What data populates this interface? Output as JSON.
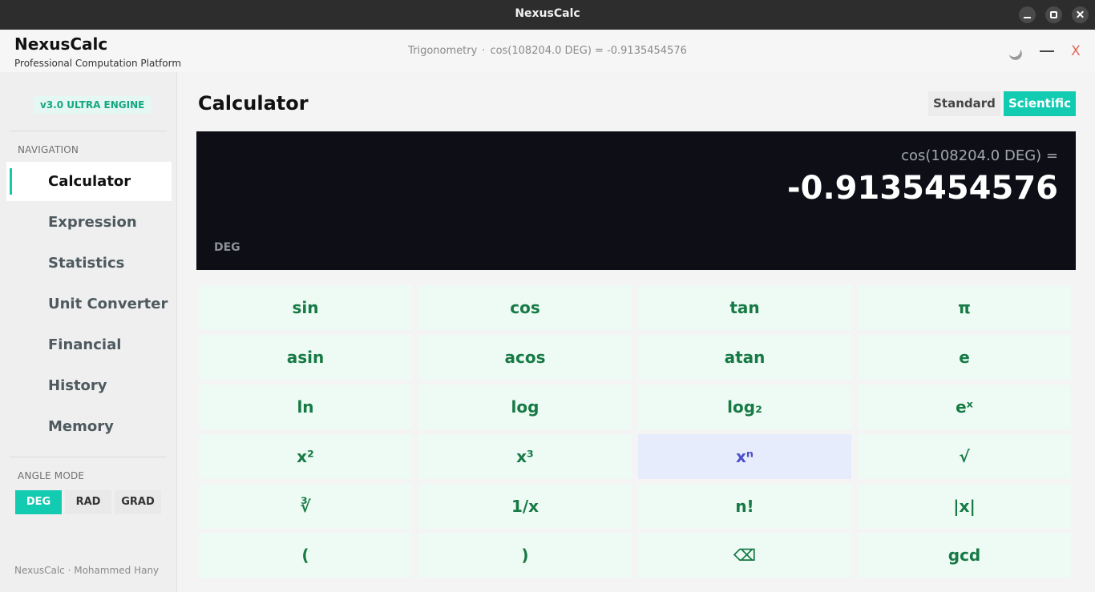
{
  "window": {
    "title": "NexusCalc"
  },
  "header": {
    "app_name": "NexusCalc",
    "tagline": "Professional Computation Platform",
    "status_category": "Trigonometry",
    "status_separator": "·",
    "status_text": "cos(108204.0 DEG) = -0.9135454576",
    "close_label": "X"
  },
  "sidebar": {
    "version_badge": "v3.0  ULTRA ENGINE",
    "nav_heading": "NAVIGATION",
    "nav_items": [
      {
        "label": "Calculator",
        "active": true
      },
      {
        "label": "Expression"
      },
      {
        "label": "Statistics"
      },
      {
        "label": "Unit Converter"
      },
      {
        "label": "Financial"
      },
      {
        "label": "History"
      },
      {
        "label": "Memory"
      }
    ],
    "angle_heading": "ANGLE MODE",
    "angle_modes": [
      {
        "label": "DEG",
        "active": true
      },
      {
        "label": "RAD"
      },
      {
        "label": "GRAD"
      }
    ],
    "footer": "NexusCalc · Mohammed Hany"
  },
  "main": {
    "title": "Calculator",
    "modes": [
      {
        "label": "Standard"
      },
      {
        "label": "Scientific",
        "active": true
      }
    ],
    "display": {
      "expression": "cos(108204.0 DEG) =",
      "result": "-0.9135454576",
      "angle_mode": "DEG"
    },
    "keys": [
      [
        "sin",
        "cos",
        "tan",
        "π"
      ],
      [
        "asin",
        "acos",
        "atan",
        "e"
      ],
      [
        "ln",
        "log",
        "log₂",
        "eˣ"
      ],
      [
        "x²",
        "x³",
        "xⁿ",
        "√"
      ],
      [
        "∛",
        "1/x",
        "n!",
        "|x|"
      ],
      [
        "(",
        ")",
        "⌫",
        "gcd"
      ]
    ],
    "highlighted_key": "xⁿ"
  },
  "colors": {
    "accent": "#13cbb1",
    "key_background": "#eefbf5",
    "key_text": "#177a45",
    "display_background": "#0e0f16"
  }
}
